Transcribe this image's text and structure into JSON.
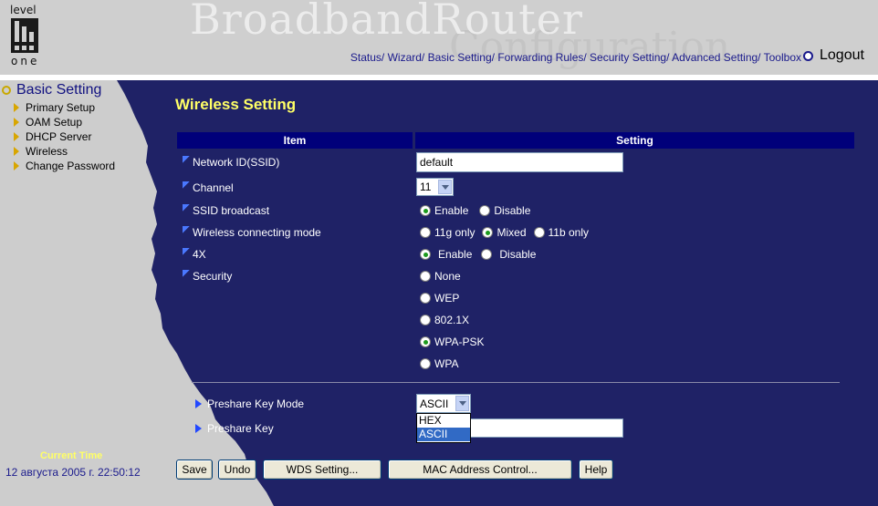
{
  "header": {
    "logo_top": "level",
    "logo_bottom": "one",
    "brand": "BroadbandRouter",
    "brand_sub": "Configuration",
    "nav_links": [
      "Status/",
      "Wizard/",
      "Basic Setting/",
      "Forwarding Rules/",
      "Security Setting/",
      "Advanced Setting/",
      "Toolbox"
    ],
    "logout": "Logout"
  },
  "sidebar": {
    "title": "Basic Setting",
    "items": [
      "Primary Setup",
      "OAM Setup",
      "DHCP Server",
      "Wireless",
      "Change Password"
    ],
    "current_time_label": "Current Time",
    "current_time_value": "12 августа 2005 г. 22:50:12"
  },
  "main": {
    "title": "Wireless Setting",
    "col_item": "Item",
    "col_setting": "Setting",
    "ssid": {
      "label": "Network ID(SSID)",
      "value": "default"
    },
    "channel": {
      "label": "Channel",
      "value": "11"
    },
    "ssid_broadcast": {
      "label": "SSID broadcast",
      "options": [
        "Enable",
        "Disable"
      ],
      "selected": "Enable"
    },
    "mode": {
      "label": "Wireless connecting mode",
      "options": [
        "11g only",
        "Mixed",
        "11b only"
      ],
      "selected": "Mixed"
    },
    "fourx": {
      "label": "4X",
      "options": [
        "Enable",
        "Disable"
      ],
      "selected": "Enable"
    },
    "security": {
      "label": "Security",
      "options": [
        "None",
        "WEP",
        "802.1X",
        "WPA-PSK",
        "WPA"
      ],
      "selected": "WPA-PSK"
    },
    "preshare_mode": {
      "label": "Preshare Key Mode",
      "value": "ASCII",
      "dropdown_options": [
        "HEX",
        "ASCII"
      ],
      "highlighted": "ASCII"
    },
    "preshare_key": {
      "label": "Preshare Key",
      "value": ""
    }
  },
  "buttons": {
    "save": "Save",
    "undo": "Undo",
    "wds": "WDS Setting...",
    "mac": "MAC Address Control...",
    "help": "Help"
  },
  "colors": {
    "panel_blue": "#1f2266",
    "header_blue": "#00007a",
    "title_yellow": "#ffff66",
    "header_gray": "#cfcfcf"
  }
}
